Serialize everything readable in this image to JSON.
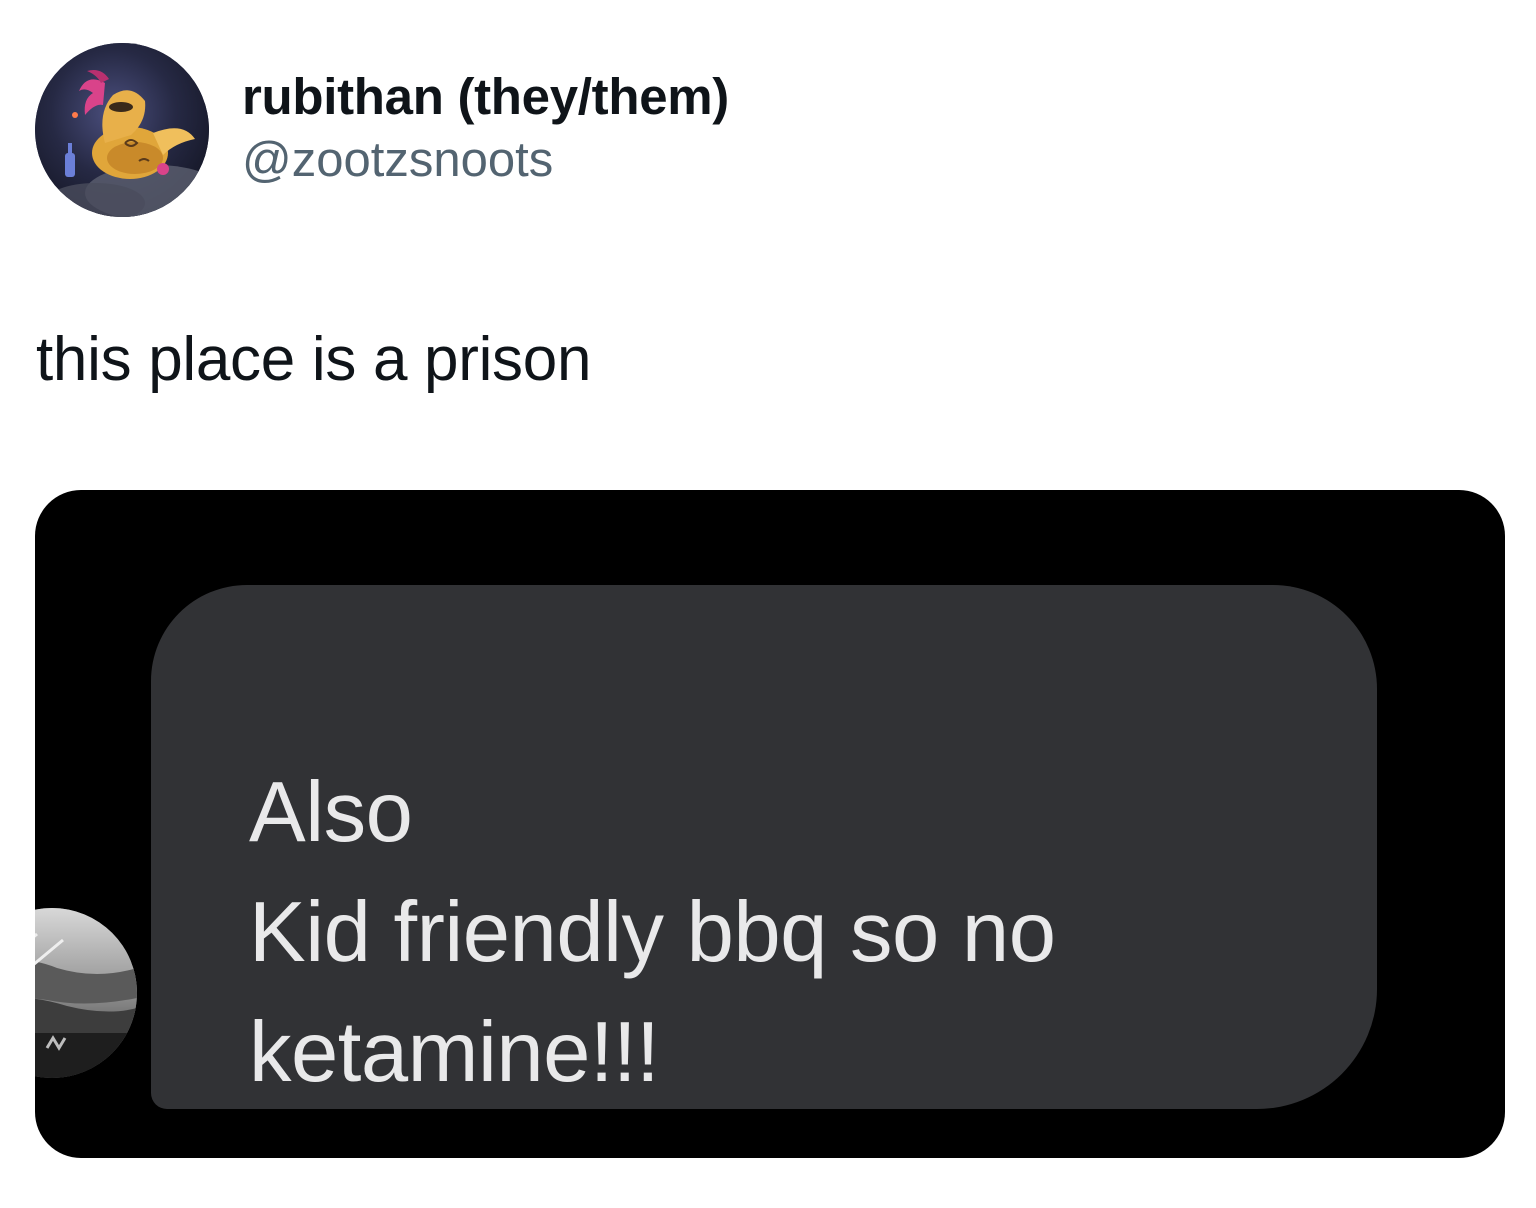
{
  "post": {
    "author": {
      "display_name": "rubithan (they/them)",
      "handle": "@zootzsnoots",
      "avatar_icon": "avatar-cartoon-pony"
    },
    "text": "this place is a prison",
    "attached_screenshot": {
      "message_lines": [
        "Also",
        "Kid friendly bbq so no",
        "ketamine!!!"
      ],
      "sender_avatar_icon": "avatar-photo-grayscale",
      "bubble_color": "#313235",
      "background_color": "#000000",
      "text_color": "#e9e9ea"
    }
  },
  "colors": {
    "primary_text": "#0f1419",
    "secondary_text": "#536471",
    "page_background": "#ffffff"
  }
}
